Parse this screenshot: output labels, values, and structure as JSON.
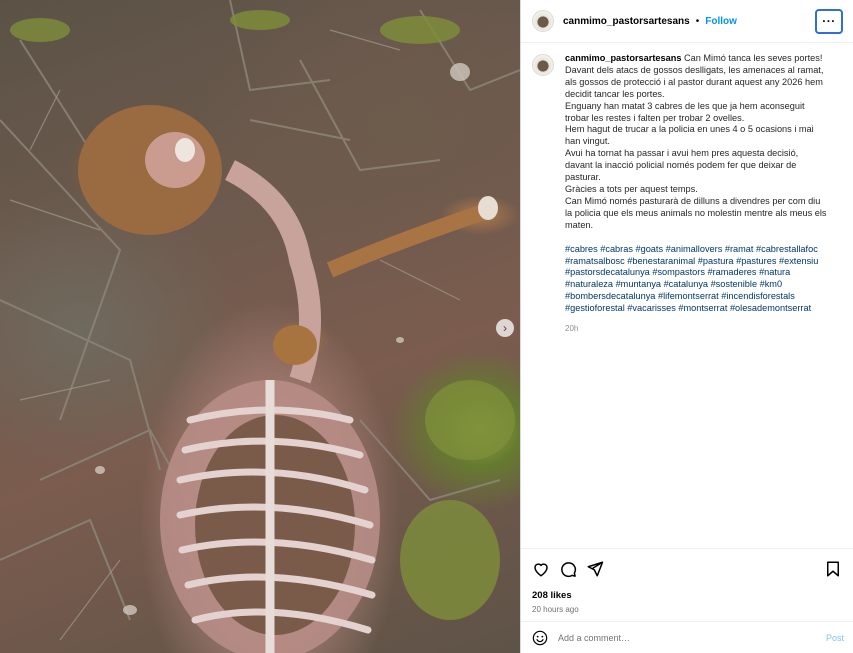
{
  "photo": {
    "description_icon": "carcass-photo",
    "next_icon": "chevron-right-icon"
  },
  "header": {
    "username": "canmimo_pastorsartesans",
    "separator": "•",
    "follow_label": "Follow",
    "more_icon": "more-horizontal-icon",
    "more_label": "···"
  },
  "caption": {
    "username": "canmimo_pastorsartesans",
    "lines": [
      "Can Mimó tanca les seves portes!",
      "Davant dels atacs de gossos deslligats, les amenaces al ramat, als gossos de protecció i al pastor durant aquest any 2026 hem decidit tancar les portes.",
      "Enguany han matat 3 cabres de les que ja hem aconseguit trobar les restes i falten per trobar 2 ovelles.",
      "Hem hagut de trucar a la policia en unes 4 o 5 ocasions i mai han vingut.",
      "Avui ha tornat ha passar i avui hem pres aquesta decisió, davant la inacció policial només podem fer que deixar de pasturar.",
      "Gràcies a tots per aquest temps.",
      "Can Mimó només pasturarà de dilluns a divendres per com diu la policia que els meus animals no molestin mentre als meus els maten."
    ],
    "hashtags": "#cabres #cabras #goats #animallovers  #ramat #cabrestallafoc #ramatsalbosc #benestaranimal #pastura #pastures #extensiu #pastorsdecatalunya #sompastors #ramaderes #natura #naturaleza #muntanya #catalunya #sostenible #km0 #bombersdecatalunya #lifemontserrat #incendisforestals #gestioforestal #vacarisses #montserrat #olesademontserrat",
    "time": "20h"
  },
  "actions": {
    "like_icon": "heart-icon",
    "comment_icon": "comment-icon",
    "share_icon": "share-icon",
    "save_icon": "bookmark-icon",
    "likes": "208 likes",
    "posted_ago": "20 hours ago"
  },
  "comment": {
    "emoji_icon": "emoji-icon",
    "placeholder": "Add a comment…",
    "post_label": "Post"
  },
  "colors": {
    "link": "#0095f6",
    "hashtag": "#00376b",
    "focus_ring": "#2f6fd6",
    "post_disabled": "#7fc4f7"
  }
}
